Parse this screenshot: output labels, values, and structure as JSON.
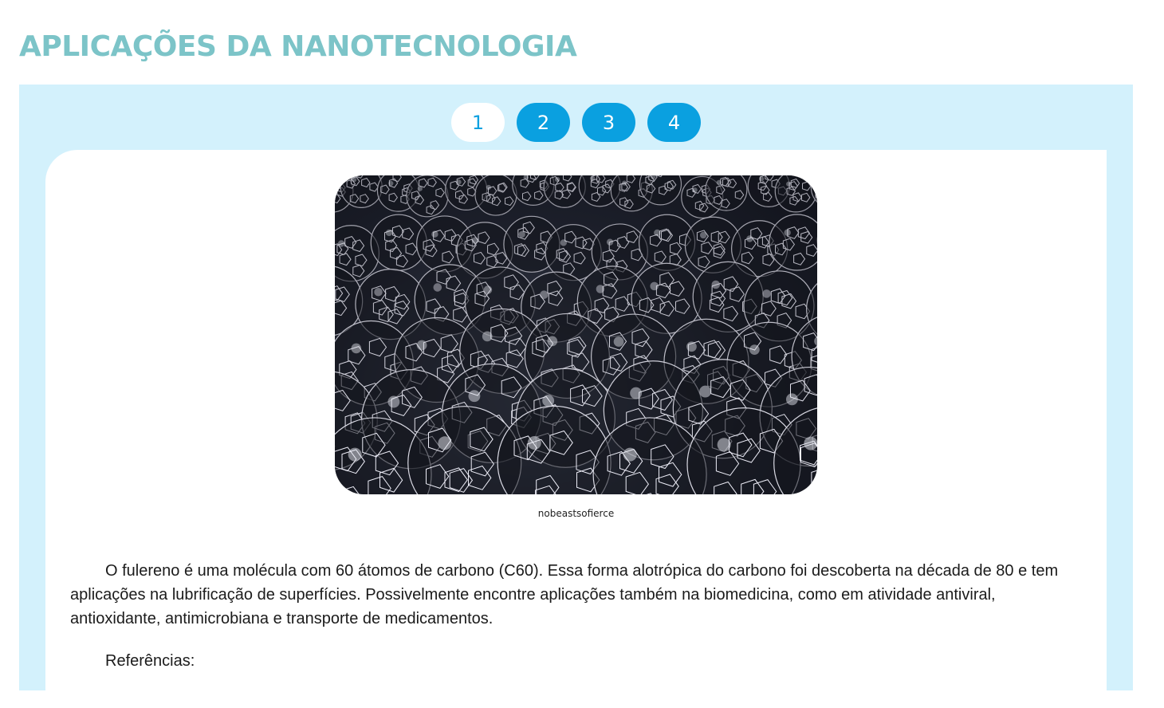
{
  "page": {
    "title": "APLICAÇÕES DA NANOTECNOLOGIA"
  },
  "tabs": [
    {
      "label": "1",
      "active": true
    },
    {
      "label": "2",
      "active": false
    },
    {
      "label": "3",
      "active": false
    },
    {
      "label": "4",
      "active": false
    }
  ],
  "content": {
    "image_icon": "fullerene-molecules-image",
    "caption": "nobeastsofierce",
    "paragraph": "O fulereno é uma molécula com 60 átomos de carbono (C60). Essa forma alotrópica do carbono foi descoberta na década de 80 e tem aplicações na lubrificação de superfícies. Possivelmente encontre aplicações também na biomedicina, como em atividade antiviral, antioxidante, antimicrobiana e transporte de medicamentos.",
    "references_label": "Referências:"
  },
  "colors": {
    "title": "#7cc4c8",
    "panel_bg": "#d3f1fc",
    "tab_active_bg": "#ffffff",
    "tab_bg": "#0aa0e0"
  }
}
